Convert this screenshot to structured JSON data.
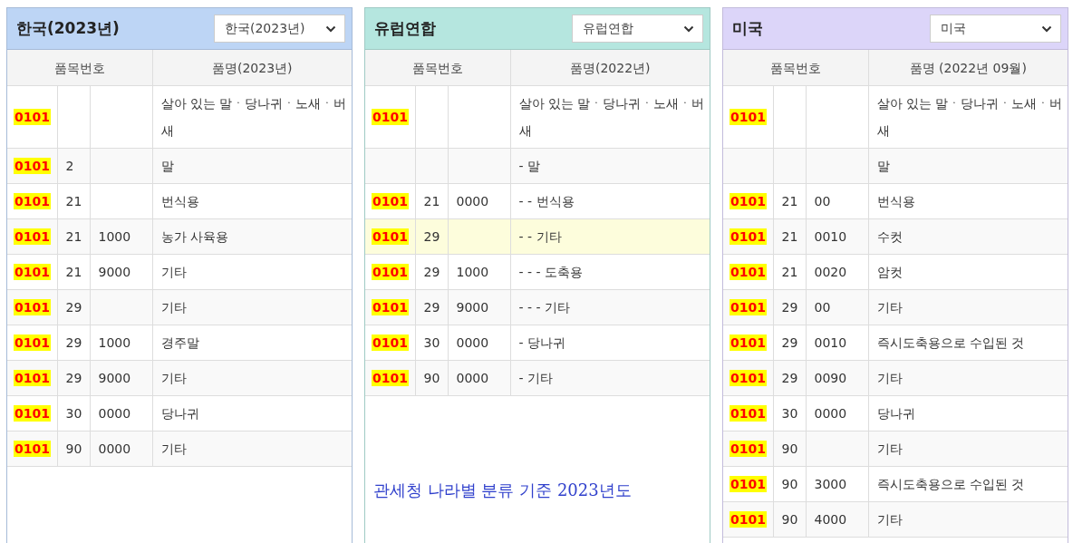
{
  "panels": [
    {
      "title": "한국(2023년)",
      "select": "한국(2023년)",
      "color": "#bdd5f5",
      "columns": [
        "품목번호",
        "품명(2023년)"
      ],
      "rows": [
        {
          "code": "0101",
          "name": "살아 있는 말ㆍ당나귀ㆍ노새ㆍ버새"
        },
        {
          "code": "0101",
          "sub": "2",
          "name": "말"
        },
        {
          "code": "0101",
          "sub": "21",
          "name": "번식용"
        },
        {
          "code": "0101",
          "sub": "21",
          "sub2": "1000",
          "name": "농가 사육용"
        },
        {
          "code": "0101",
          "sub": "21",
          "sub2": "9000",
          "name": "기타"
        },
        {
          "code": "0101",
          "sub": "29",
          "name": "기타"
        },
        {
          "code": "0101",
          "sub": "29",
          "sub2": "1000",
          "name": "경주말"
        },
        {
          "code": "0101",
          "sub": "29",
          "sub2": "9000",
          "name": "기타"
        },
        {
          "code": "0101",
          "sub": "30",
          "sub2": "0000",
          "name": "당나귀"
        },
        {
          "code": "0101",
          "sub": "90",
          "sub2": "0000",
          "name": "기타"
        }
      ]
    },
    {
      "title": "유럽연합",
      "select": "유럽연합",
      "color": "#b5e6df",
      "columns": [
        "품목번호",
        "품명(2022년)"
      ],
      "note": "관세청 나라별 분류 기준 2023년도",
      "rows": [
        {
          "code": "0101",
          "name": "살아 있는 말ㆍ당나귀ㆍ노새ㆍ버새",
          "highlighted": false
        },
        {
          "name": "- 말",
          "highlighted": false
        },
        {
          "code": "0101",
          "sub": "21",
          "sub2": "0000",
          "name": "- - 번식용",
          "highlighted": false
        },
        {
          "code": "0101",
          "sub": "29",
          "name": "- - 기타",
          "highlighted": true
        },
        {
          "code": "0101",
          "sub": "29",
          "sub2": "1000",
          "name": "- - - 도축용",
          "highlighted": false
        },
        {
          "code": "0101",
          "sub": "29",
          "sub2": "9000",
          "name": "- - - 기타",
          "highlighted": false
        },
        {
          "code": "0101",
          "sub": "30",
          "sub2": "0000",
          "name": "- 당나귀",
          "highlighted": false
        },
        {
          "code": "0101",
          "sub": "90",
          "sub2": "0000",
          "name": "- 기타",
          "highlighted": false
        }
      ]
    },
    {
      "title": "미국",
      "select": "미국",
      "color": "#dcd5f9",
      "columns": [
        "품목번호",
        "품명 (2022년 09월)"
      ],
      "rows": [
        {
          "code": "0101",
          "name": "살아 있는 말ㆍ당나귀ㆍ노새ㆍ버새"
        },
        {
          "name": "말"
        },
        {
          "code": "0101",
          "sub": "21",
          "sub2": "00",
          "name": "번식용"
        },
        {
          "code": "0101",
          "sub": "21",
          "sub2": "0010",
          "name": "수컷"
        },
        {
          "code": "0101",
          "sub": "21",
          "sub2": "0020",
          "name": "암컷"
        },
        {
          "code": "0101",
          "sub": "29",
          "sub2": "00",
          "name": "기타"
        },
        {
          "code": "0101",
          "sub": "29",
          "sub2": "0010",
          "name": "즉시도축용으로 수입된 것"
        },
        {
          "code": "0101",
          "sub": "29",
          "sub2": "0090",
          "name": "기타"
        },
        {
          "code": "0101",
          "sub": "30",
          "sub2": "0000",
          "name": "당나귀"
        },
        {
          "code": "0101",
          "sub": "90",
          "name": "기타"
        },
        {
          "code": "0101",
          "sub": "90",
          "sub2": "3000",
          "name": "즉시도축용으로 수입된 것"
        },
        {
          "code": "0101",
          "sub": "90",
          "sub2": "4000",
          "name": "기타"
        }
      ]
    }
  ]
}
